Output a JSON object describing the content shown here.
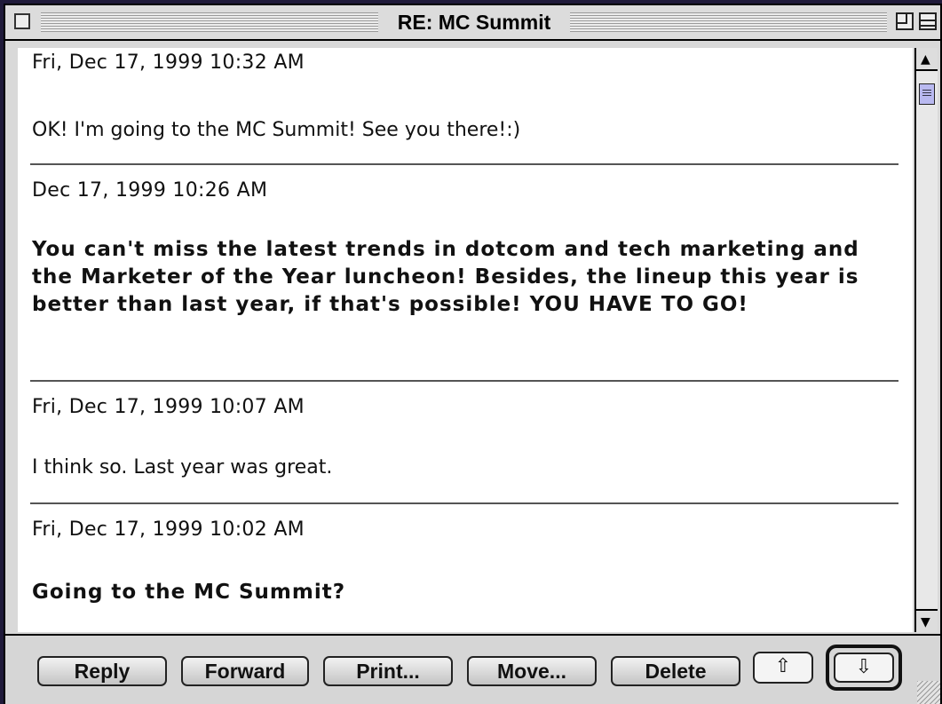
{
  "window": {
    "title": "RE: MC Summit"
  },
  "messages": [
    {
      "date": "Fri, Dec 17, 1999 10:32 AM",
      "body": "OK!  I'm going to the MC Summit!  See you there!:)"
    },
    {
      "date": "Dec 17, 1999 10:26 AM",
      "body": "You can't miss the latest trends in dotcom and tech marketing and the Marketer of the Year luncheon! Besides, the lineup this year is better than last year, if that's possible! YOU HAVE TO GO!"
    },
    {
      "date": "Fri, Dec 17, 1999 10:07 AM",
      "body": "I think so. Last year was great."
    },
    {
      "date": "Fri, Dec 17, 1999 10:02 AM",
      "body": "Going to the MC Summit?"
    }
  ],
  "toolbar": {
    "reply_label": "Reply",
    "forward_label": "Forward",
    "print_label": "Print...",
    "move_label": "Move...",
    "delete_label": "Delete",
    "prev_arrow": "⇧",
    "next_arrow": "⇩"
  },
  "icons": {
    "close": "close-box-icon",
    "zoom": "zoom-box-icon",
    "collapse": "collapse-box-icon",
    "scroll_up": "up-arrow-icon",
    "scroll_down": "down-arrow-icon",
    "grow": "resize-grip-icon"
  }
}
